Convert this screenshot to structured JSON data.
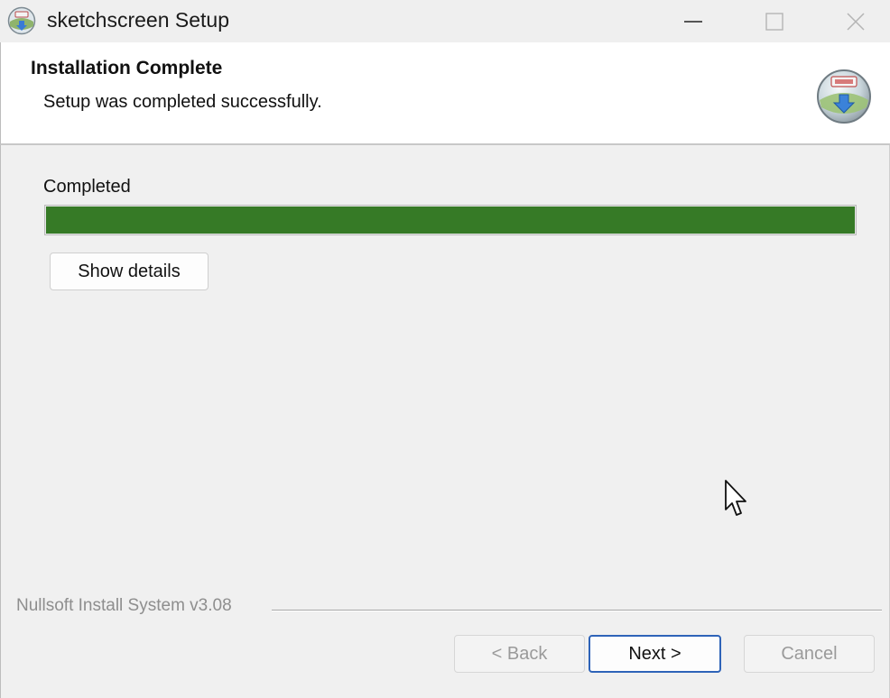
{
  "window": {
    "title": "sketchscreen Setup",
    "icon": "installer-globe-icon"
  },
  "title_controls": {
    "minimize_icon": "minimize-icon",
    "maximize_icon": "maximize-icon",
    "close_icon": "close-icon"
  },
  "header": {
    "title": "Installation Complete",
    "subtitle": "Setup was completed successfully.",
    "logo_icon": "nsis-logo-icon"
  },
  "progress": {
    "label": "Completed",
    "percent": 100,
    "color": "#367a26"
  },
  "details_button": {
    "label": "Show details"
  },
  "branding": {
    "text": "Nullsoft Install System v3.08"
  },
  "buttons": {
    "back": {
      "label": "< Back",
      "enabled": false
    },
    "next": {
      "label": "Next >",
      "enabled": true,
      "focused": true
    },
    "cancel": {
      "label": "Cancel",
      "enabled": false
    }
  },
  "colors": {
    "accent_focus": "#2e63b8",
    "progress_fill": "#367a26",
    "disabled_text": "#9a9a9a"
  }
}
